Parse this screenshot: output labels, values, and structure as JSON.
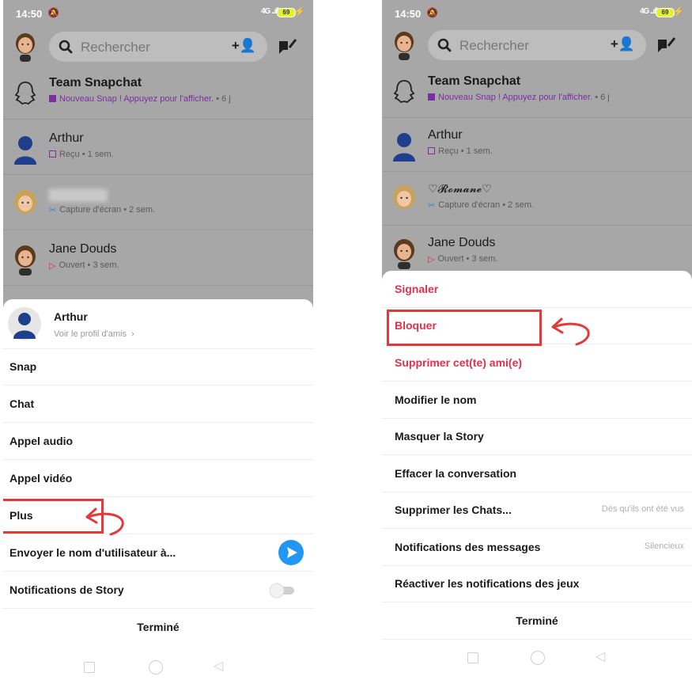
{
  "phones": [
    {
      "status": {
        "time": "14:50",
        "signal": "4G ..ıll",
        "battery": "69"
      },
      "search": {
        "placeholder": "Rechercher"
      },
      "chats": [
        {
          "name": "Team Snapchat",
          "sub": "Nouveau Snap ! Appuyez pour l'afficher.",
          "age": "• 6 j"
        },
        {
          "name": "Arthur",
          "sub": "Reçu",
          "age": "• 1 sem."
        },
        {
          "name": "",
          "sub": "Capture d'écran",
          "age": "• 2 sem."
        },
        {
          "name": "Jane Douds",
          "sub": "Ouvert",
          "age": "• 3 sem."
        }
      ],
      "sheet": {
        "profile_name": "Arthur",
        "profile_link": "Voir le profil d'amis",
        "items": [
          "Snap",
          "Chat",
          "Appel audio",
          "Appel vidéo",
          "Plus",
          "Envoyer le nom d'utilisateur à...",
          "Notifications de Story"
        ],
        "done": "Terminé"
      }
    },
    {
      "status": {
        "time": "14:50",
        "signal": "4G ..ıll",
        "battery": "69"
      },
      "search": {
        "placeholder": "Rechercher"
      },
      "chats": [
        {
          "name": "Team Snapchat",
          "sub": "Nouveau Snap ! Appuyez pour l'afficher.",
          "age": "• 6 j"
        },
        {
          "name": "Arthur",
          "sub": "Reçu",
          "age": "• 1 sem."
        },
        {
          "name": "♡𝓡𝓸𝓶𝓪𝓷𝓮♡",
          "sub": "Capture d'écran",
          "age": "• 2 sem."
        },
        {
          "name": "Jane Douds",
          "sub": "Ouvert",
          "age": "• 3 sem."
        }
      ],
      "sheet": {
        "items": [
          {
            "label": "Signaler",
            "value": ""
          },
          {
            "label": "Bloquer",
            "value": ""
          },
          {
            "label": "Supprimer cet(te) ami(e)",
            "value": ""
          },
          {
            "label": "Modifier le nom",
            "value": ""
          },
          {
            "label": "Masquer la Story",
            "value": ""
          },
          {
            "label": "Effacer la conversation",
            "value": ""
          },
          {
            "label": "Supprimer les Chats...",
            "value": "Dès qu'ils ont été vus"
          },
          {
            "label": "Notifications des messages",
            "value": "Silencieux"
          },
          {
            "label": "Réactiver les notifications des jeux",
            "value": ""
          }
        ],
        "done": "Terminé"
      }
    }
  ],
  "colors": {
    "danger": "#e0304a",
    "highlight": "#e23a3a",
    "send": "#2196f3",
    "overlay": "#a7a7a7",
    "snap_purple": "#7a2fa0"
  },
  "icons": [
    "search-icon",
    "add-friend-icon",
    "new-chat-icon",
    "ghost-icon",
    "send-arrow-icon",
    "toggle-icon",
    "chevron-right-icon"
  ]
}
